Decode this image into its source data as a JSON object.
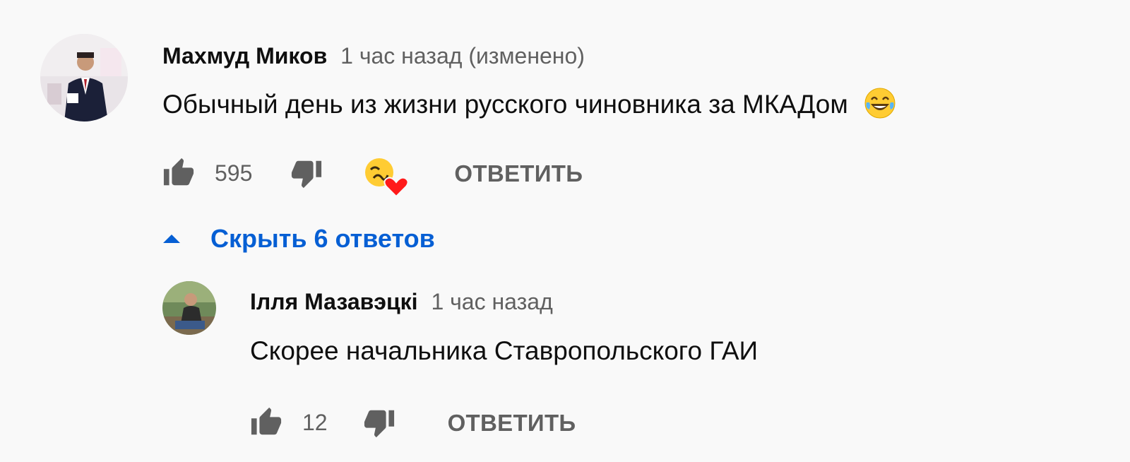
{
  "comments": [
    {
      "author": "Махмуд Миков",
      "time": "1 час назад (изменено)",
      "text": "Обычный день из жизни русского чиновника за МКАДом",
      "text_emoji": "laughing-tears-emoji",
      "likes": "595",
      "reply_label": "ОТВЕТИТЬ",
      "creator_heart": true
    }
  ],
  "replies_toggle": {
    "label": "Скрыть 6 ответов",
    "icon": "caret-up-icon"
  },
  "replies": [
    {
      "author": "Ілля Мазавэцкі",
      "time": "1 час назад",
      "text": "Скорее начальника Ставропольского ГАИ",
      "likes": "12",
      "reply_label": "ОТВЕТИТЬ"
    }
  ],
  "colors": {
    "background": "#f9f9f9",
    "text": "#0f0f0f",
    "secondary": "#606060",
    "link_blue": "#065fd4",
    "heart_red": "#ff0000",
    "emoji_yellow": "#ffcc33"
  }
}
